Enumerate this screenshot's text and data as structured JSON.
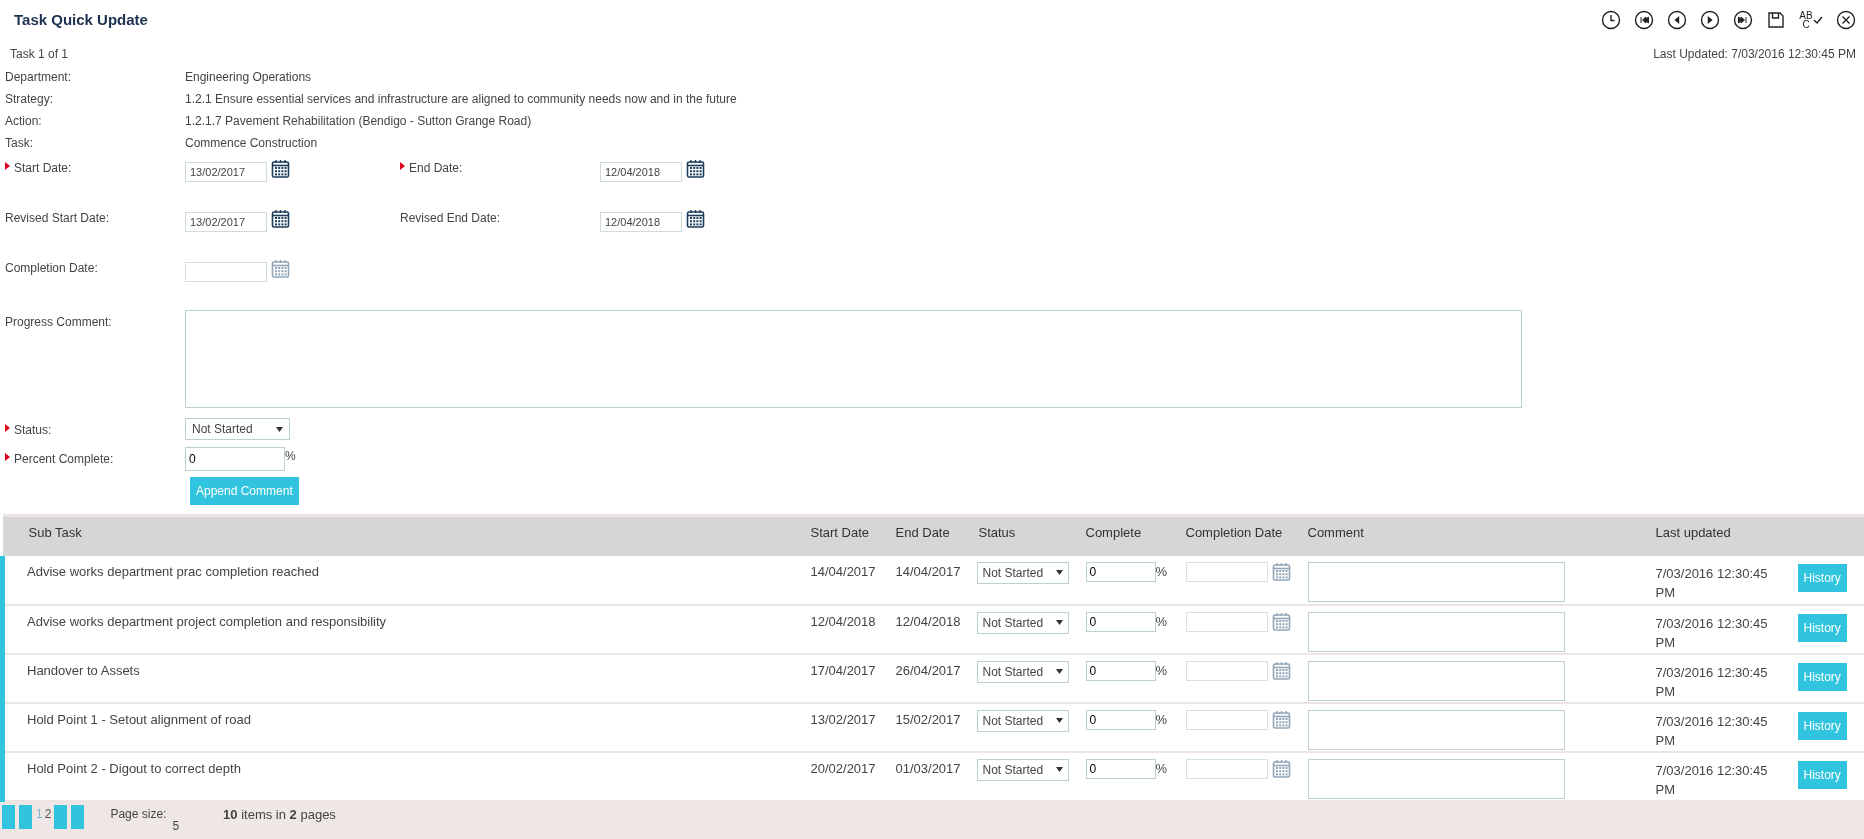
{
  "window": {
    "title": "Task Quick Update"
  },
  "toolbar": [
    {
      "kind": "clock"
    },
    {
      "kind": "first"
    },
    {
      "kind": "prev"
    },
    {
      "kind": "next"
    },
    {
      "kind": "last"
    },
    {
      "kind": "save"
    },
    {
      "kind": "spellcheck",
      "letters": [
        "AB",
        "C"
      ]
    },
    {
      "kind": "close"
    }
  ],
  "record_position": "Task 1 of 1",
  "last_updated": "Last Updated: 7/03/2016 12:30:45 PM",
  "details": [
    {
      "label": "Department:",
      "value": "Engineering Operations"
    },
    {
      "label": "Strategy:",
      "value": "1.2.1 Ensure essential services and infrastructure are aligned to community needs now and in the future"
    },
    {
      "label": "Action:",
      "value": "1.2.1.7 Pavement Rehabilitation (Bendigo - Sutton Grange Road)"
    },
    {
      "label": "Task:",
      "value": "Commence Construction"
    }
  ],
  "date_rows": [
    {
      "fields": [
        {
          "label": "Start Date:",
          "required": true,
          "value": "13/02/2017",
          "disabled": false
        },
        {
          "label": "End Date:",
          "required": true,
          "value": "12/04/2018",
          "disabled": false
        }
      ]
    },
    {
      "fields": [
        {
          "label": "Revised Start Date:",
          "required": false,
          "value": "13/02/2017",
          "disabled": false
        },
        {
          "label": "Revised End Date:",
          "required": false,
          "value": "12/04/2018",
          "disabled": false
        }
      ]
    },
    {
      "fields": [
        {
          "label": "Completion Date:",
          "required": false,
          "disabled": true
        }
      ]
    }
  ],
  "progress_comment": {
    "label": "Progress Comment:"
  },
  "status": {
    "label": "Status:",
    "required": true,
    "value": "Not Started"
  },
  "percent_complete": {
    "label": "Percent Complete:",
    "required": true,
    "value": "0",
    "unit": "%"
  },
  "append_button": "Append Comment",
  "subtasks": {
    "columns": [
      "Sub Task",
      "Start Date",
      "End Date",
      "Status",
      "Complete",
      "Completion Date",
      "Comment",
      "Last updated"
    ],
    "rows": [
      {
        "name": "Advise works department prac completion reached",
        "start": "14/04/2017",
        "end": "14/04/2017",
        "status": "Not Started",
        "complete": "0",
        "unit": "%",
        "last_updated": "7/03/2016 12:30:45 PM",
        "history": "History"
      },
      {
        "name": "Advise works department project completion and responsibility",
        "start": "12/04/2018",
        "end": "12/04/2018",
        "status": "Not Started",
        "complete": "0",
        "unit": "%",
        "last_updated": "7/03/2016 12:30:45 PM",
        "history": "History"
      },
      {
        "name": "Handover to Assets",
        "start": "17/04/2017",
        "end": "26/04/2017",
        "status": "Not Started",
        "complete": "0",
        "unit": "%",
        "last_updated": "7/03/2016 12:30:45 PM",
        "history": "History"
      },
      {
        "name": "Hold Point 1 - Setout alignment of road",
        "start": "13/02/2017",
        "end": "15/02/2017",
        "status": "Not Started",
        "complete": "0",
        "unit": "%",
        "last_updated": "7/03/2016 12:30:45 PM",
        "history": "History"
      },
      {
        "name": "Hold Point 2 - Digout to correct depth",
        "start": "20/02/2017",
        "end": "01/03/2017",
        "status": "Not Started",
        "complete": "0",
        "unit": "%",
        "last_updated": "7/03/2016 12:30:45 PM",
        "history": "History"
      }
    ]
  },
  "pager": {
    "pages": [
      {
        "label": "1",
        "selected": true
      },
      {
        "label": "2",
        "selected": false
      }
    ],
    "page_size_label": "Page size:",
    "page_size": "5",
    "summary": "**10** items in **2** pages"
  }
}
